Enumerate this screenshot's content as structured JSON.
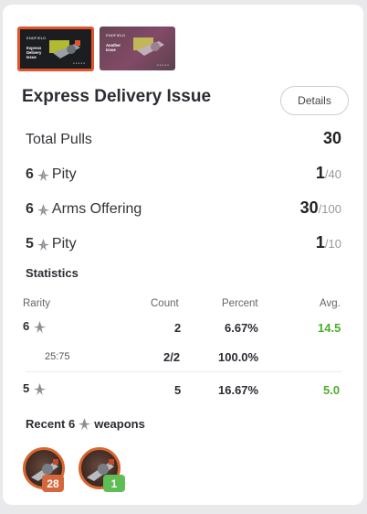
{
  "banner": {
    "thumbnails": [
      {
        "logo": "ENDFIELD",
        "title": "Express Delivery Issue",
        "selected": true
      },
      {
        "logo": "ENDFIELD",
        "title": "Another Issue",
        "selected": false
      }
    ],
    "title": "Express Delivery Issue",
    "details_label": "Details"
  },
  "summary": {
    "total_pulls": {
      "label": "Total Pulls",
      "value": "30"
    },
    "six_pity": {
      "rank": "6",
      "label": "Pity",
      "value": "1",
      "denominator": "/40"
    },
    "six_arms": {
      "rank": "6",
      "label": "Arms Offering",
      "value": "30",
      "denominator": "/100"
    },
    "five_pity": {
      "rank": "5",
      "label": "Pity",
      "value": "1",
      "denominator": "/10"
    }
  },
  "statistics": {
    "heading": "Statistics",
    "columns": {
      "rarity": "Rarity",
      "count": "Count",
      "percent": "Percent",
      "avg": "Avg."
    },
    "rows": [
      {
        "rarity": "6",
        "count": "2",
        "percent": "6.67%",
        "avg": "14.5"
      },
      {
        "rarity": "25:75",
        "count": "2/2",
        "percent": "100.0%",
        "avg": ""
      },
      {
        "rarity": "5",
        "count": "5",
        "percent": "16.67%",
        "avg": "5.0"
      }
    ]
  },
  "recent": {
    "heading_prefix": "Recent 6",
    "heading_suffix": "weapons",
    "weapons": [
      {
        "icon": "weapon-icon",
        "pulls": "28",
        "badge_color": "#d4673c"
      },
      {
        "icon": "weapon-icon",
        "pulls": "1",
        "badge_color": "#5fbd55"
      }
    ]
  },
  "colors": {
    "accent": "#e0532b",
    "good": "#4cae2b",
    "badge_orange": "#d4673c",
    "badge_green": "#5fbd55"
  }
}
